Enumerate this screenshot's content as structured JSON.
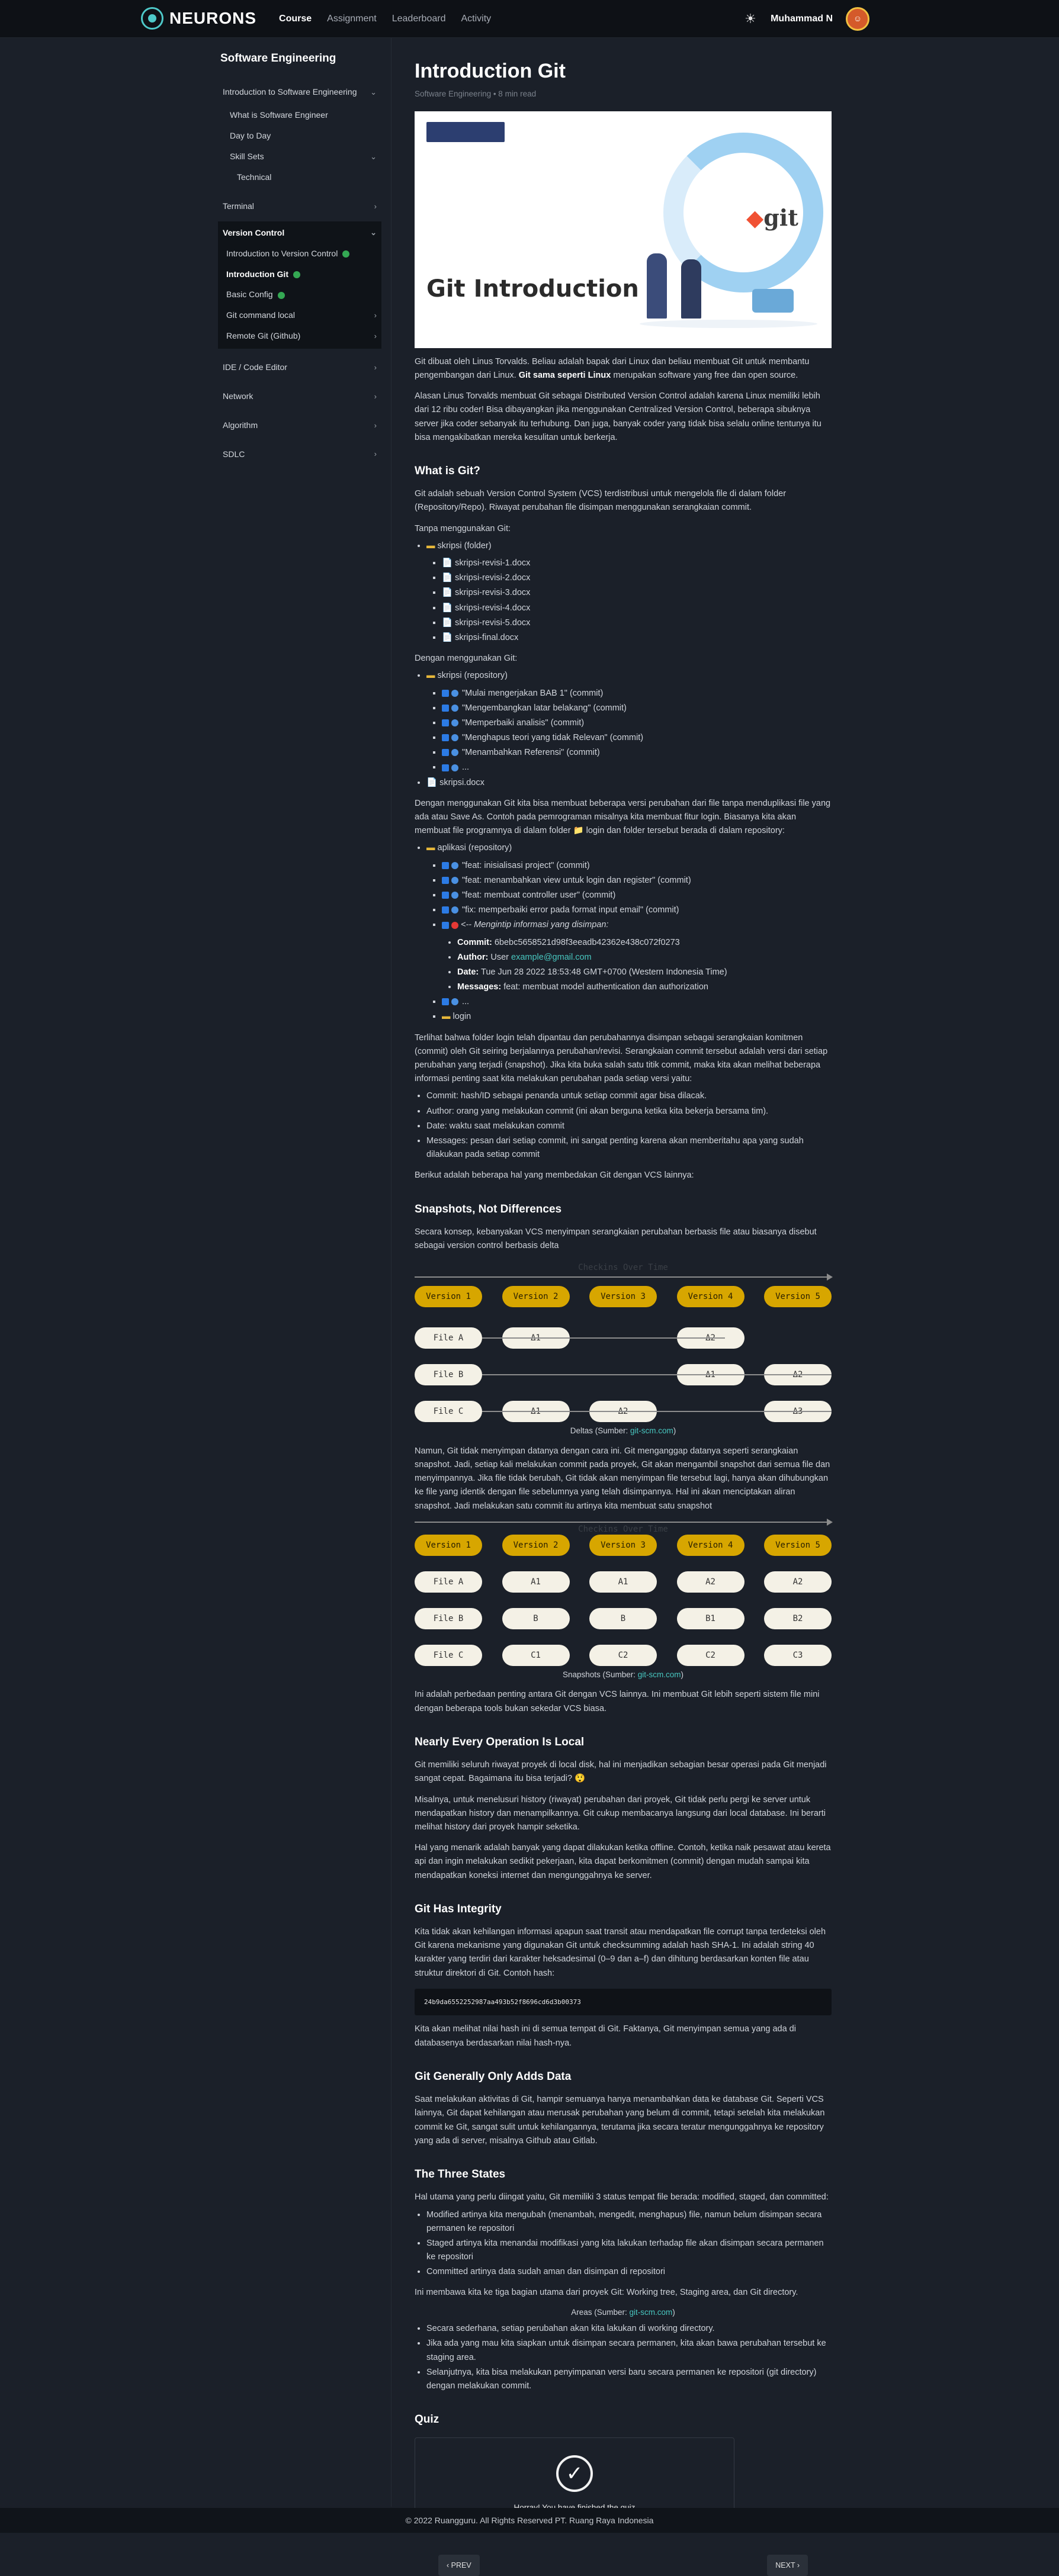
{
  "nav": {
    "brand": "NEURONS",
    "links": [
      "Course",
      "Assignment",
      "Leaderboard",
      "Activity"
    ],
    "user": "Muhammad N"
  },
  "sidebar": {
    "title": "Software Engineering",
    "intro_group": "Introduction to Software Engineering",
    "intro_items": [
      "What is Software Engineer",
      "Day to Day"
    ],
    "skill_sets": "Skill Sets",
    "technical": "Technical",
    "terminal": "Terminal",
    "version_control": "Version Control",
    "vc_items": [
      "Introduction to Version Control",
      "Introduction Git",
      "Basic Config",
      "Git command local",
      "Remote Git (Github)"
    ],
    "groups": [
      "IDE / Code Editor",
      "Network",
      "Algorithm",
      "SDLC"
    ]
  },
  "article": {
    "title": "Introduction Git",
    "meta": "Software Engineering • 8 min read",
    "hero_title": "Git Introduction",
    "hero_logo": "git",
    "p1a": "Git dibuat oleh Linus Torvalds. Beliau adalah bapak dari Linux dan beliau membuat Git untuk membantu pengembangan dari Linux.",
    "p1b": "Git sama seperti Linux",
    "p1c": "merupakan software yang free dan open source.",
    "p2": "Alasan Linus Torvalds membuat Git sebagai Distributed Version Control adalah karena Linux memiliki lebih dari 12 ribu coder! Bisa dibayangkan jika menggunakan Centralized Version Control, beberapa sibuknya server jika coder sebanyak itu terhubung. Dan juga, banyak coder yang tidak bisa selalu online tentunya itu bisa mengakibatkan mereka kesulitan untuk berkerja.",
    "h_what": "What is Git?",
    "p3": "Git adalah sebuah Version Control System (VCS) terdistribusi untuk mengelola file di dalam folder (Repository/Repo). Riwayat perubahan file disimpan menggunakan serangkaian commit.",
    "without_git": "Tanpa menggunakan Git:",
    "tree1_root": "skripsi (folder)",
    "tree1_items": [
      "skripsi-revisi-1.docx",
      "skripsi-revisi-2.docx",
      "skripsi-revisi-3.docx",
      "skripsi-revisi-4.docx",
      "skripsi-revisi-5.docx",
      "skripsi-final.docx"
    ],
    "with_git": "Dengan menggunakan Git:",
    "tree2_root": "skripsi (repository)",
    "tree2_items": [
      "\"Mulai mengerjakan BAB 1\" (commit)",
      "\"Mengembangkan latar belakang\" (commit)",
      "\"Memperbaiki analisis\" (commit)",
      "\"Menghapus teori yang tidak Relevan\" (commit)",
      "\"Menambahkan Referensi\" (commit)",
      "..."
    ],
    "tree2_file": "skripsi.docx",
    "p4": "Dengan menggunakan Git kita bisa membuat beberapa versi perubahan dari file tanpa menduplikasi file yang ada atau Save As. Contoh pada pemrograman misalnya kita membuat fitur login. Biasanya kita akan membuat file programnya di dalam folder 📁 login dan folder tersebut berada di dalam repository:",
    "tree3_root": "aplikasi (repository)",
    "tree3_items": [
      "\"feat: inisialisasi project\" (commit)",
      "\"feat: menambahkan view untuk login dan register\" (commit)",
      "\"feat: membuat controller user\" (commit)",
      "\"fix: memperbaiki error pada format input email\" (commit)"
    ],
    "tree3_info": "<-- Mengintip informasi yang disimpan:",
    "commit_label": "Commit:",
    "commit_val": "6bebc5658521d98f3eeadb42362e438c072f0273",
    "author_label": "Author:",
    "author_val": "User",
    "author_mail": "example@gmail.com",
    "date_label": "Date:",
    "date_val": "Tue Jun 28 2022 18:53:48 GMT+0700 (Western Indonesia Time)",
    "msg_label": "Messages:",
    "msg_val": "feat: membuat model authentication dan authorization",
    "tree3_more": "...",
    "tree3_folder": "login",
    "p5": "Terlihat bahwa folder login telah dipantau dan perubahannya disimpan sebagai serangkaian komitmen (commit) oleh Git seiring berjalannya perubahan/revisi. Serangkaian commit tersebut adalah versi dari setiap perubahan yang terjadi (snapshot). Jika kita buka salah satu titik commit, maka kita akan melihat beberapa informasi penting saat kita melakukan perubahan pada setiap versi yaitu:",
    "info_items": [
      "Commit: hash/ID sebagai penanda untuk setiap commit agar bisa dilacak.",
      "Author: orang yang melakukan commit (ini akan berguna ketika kita bekerja bersama tim).",
      "Date: waktu saat melakukan commit",
      "Messages: pesan dari setiap commit, ini sangat penting karena akan memberitahu apa yang sudah dilakukan pada setiap commit"
    ],
    "p6": "Berikut adalah beberapa hal yang membedakan Git dengan VCS lainnya:",
    "h_snap": "Snapshots, Not Differences",
    "p7": "Secara konsep, kebanyakan VCS menyimpan serangkaian perubahan berbasis file atau biasanya disebut sebagai version control berbasis delta",
    "checkins": "Checkins Over Time",
    "versions": [
      "Version 1",
      "Version 2",
      "Version 3",
      "Version 4",
      "Version 5"
    ],
    "delta_rows": [
      [
        "File A",
        "Δ1",
        "",
        "Δ2",
        ""
      ],
      [
        "File B",
        "",
        "",
        "Δ1",
        "Δ2"
      ],
      [
        "File C",
        "Δ1",
        "Δ2",
        "",
        "Δ3"
      ]
    ],
    "cap1": "Deltas (Sumber:",
    "cap_link": "git-scm.com",
    "cap_end": ")",
    "p8": "Namun, Git tidak menyimpan datanya dengan cara ini. Git menganggap datanya seperti serangkaian snapshot. Jadi, setiap kali melakukan commit pada proyek, Git akan mengambil snapshot dari semua file dan menyimpannya. Jika file tidak berubah, Git tidak akan menyimpan file tersebut lagi, hanya akan dihubungkan ke file yang identik dengan file sebelumnya yang telah disimpannya. Hal ini akan menciptakan aliran snapshot. Jadi melakukan satu commit itu artinya kita membuat satu snapshot",
    "snap_rows": [
      [
        "File A",
        "A1",
        "A1",
        "A2",
        "A2"
      ],
      [
        "File B",
        "B",
        "B",
        "B1",
        "B2"
      ],
      [
        "File C",
        "C1",
        "C2",
        "C2",
        "C3"
      ]
    ],
    "cap2": "Snapshots (Sumber:",
    "p9": "Ini adalah perbedaan penting antara Git dengan VCS lainnya. Ini membuat Git lebih seperti sistem file mini dengan beberapa tools bukan sekedar VCS biasa.",
    "h_local": "Nearly Every Operation Is Local",
    "p10": "Git memiliki seluruh riwayat proyek di local disk, hal ini menjadikan sebagian besar operasi pada Git menjadi sangat cepat. Bagaimana itu bisa terjadi? 😲",
    "p11": "Misalnya, untuk menelusuri history (riwayat) perubahan dari proyek, Git tidak perlu pergi ke server untuk mendapatkan history dan menampilkannya. Git cukup membacanya langsung dari local database. Ini berarti melihat history dari proyek hampir seketika.",
    "p12": "Hal yang menarik adalah banyak yang dapat dilakukan ketika offline. Contoh, ketika naik pesawat atau kereta api dan ingin melakukan sedikit pekerjaan, kita dapat berkomitmen (commit) dengan mudah sampai kita mendapatkan koneksi internet dan mengunggahnya ke server.",
    "h_integrity": "Git Has Integrity",
    "p13": "Kita tidak akan kehilangan informasi apapun saat transit atau mendapatkan file corrupt tanpa terdeteksi oleh Git karena mekanisme yang digunakan Git untuk checksumming adalah hash SHA-1. Ini adalah string 40 karakter yang terdiri dari karakter heksadesimal (0–9 dan a–f) dan dihitung berdasarkan konten file atau struktur direktori di Git. Contoh hash:",
    "hash": "24b9da6552252987aa493b52f8696cd6d3b00373",
    "p14": "Kita akan melihat nilai hash ini di semua tempat di Git. Faktanya, Git menyimpan semua yang ada di databasenya berdasarkan nilai hash-nya.",
    "h_adds": "Git Generally Only Adds Data",
    "p15": "Saat melakukan aktivitas di Git, hampir semuanya hanya menambahkan data ke database Git. Seperti VCS lainnya, Git dapat kehilangan atau merusak perubahan yang belum di commit, tetapi setelah kita melakukan commit ke Git, sangat sulit untuk kehilangannya, terutama jika secara teratur mengunggahnya ke repository yang ada di server, misalnya Github atau Gitlab.",
    "h_states": "The Three States",
    "p16": "Hal utama yang perlu diingat yaitu, Git memiliki 3 status tempat file berada: modified, staged, dan committed:",
    "state_items": [
      "Modified artinya kita mengubah (menambah, mengedit, menghapus) file, namun belum disimpan secara permanen ke repositori",
      "Staged artinya kita menandai modifikasi yang kita lakukan terhadap file akan disimpan secara permanen ke repositori",
      "Committed artinya data sudah aman dan disimpan di repositori"
    ],
    "p17": "Ini membawa kita ke tiga bagian utama dari proyek Git: Working tree, Staging area, dan Git directory.",
    "cap3": "Areas (Sumber:",
    "area_items": [
      "Secara sederhana, setiap perubahan akan kita lakukan di working directory.",
      "Jika ada yang mau kita siapkan untuk disimpan secara permanen, kita akan bawa perubahan tersebut ke staging area.",
      "Selanjutnya, kita bisa melakukan penyimpanan versi baru secara permanen ke repositori (git directory) dengan melakukan commit."
    ],
    "h_quiz": "Quiz",
    "quiz_text": "Horray! You have finished the quiz",
    "prev": "‹ PREV",
    "next": "NEXT ›"
  },
  "footer": "© 2022 Ruangguru. All Rights Reserved PT. Ruang Raya Indonesia"
}
